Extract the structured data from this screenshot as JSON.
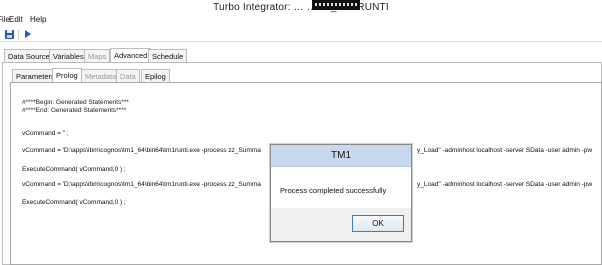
{
  "window": {
    "title": "Turbo Integrator: … … ze_Tm1RUNTI"
  },
  "menu": {
    "items": [
      "File",
      "Edit",
      "Help"
    ]
  },
  "toolbar": {
    "icons": [
      "save-icon",
      "run-icon"
    ]
  },
  "main_tabs": {
    "items": [
      {
        "label": "Data Source",
        "state": "normal"
      },
      {
        "label": "Variables",
        "state": "normal"
      },
      {
        "label": "Maps",
        "state": "disabled"
      },
      {
        "label": "Advanced",
        "state": "active"
      },
      {
        "label": "Schedule",
        "state": "normal"
      }
    ]
  },
  "sub_tabs": {
    "items": [
      {
        "label": "Parameters",
        "state": "normal"
      },
      {
        "label": "Prolog",
        "state": "active"
      },
      {
        "label": "Metadata",
        "state": "disabled"
      },
      {
        "label": "Data",
        "state": "disabled"
      },
      {
        "label": "Epilog",
        "state": "normal"
      }
    ]
  },
  "editor": {
    "lines": [
      "#****Begin: Generated Statements***",
      "#****End: Generated Statements****",
      "vCommand = '' ;",
      "vCommand = 'D:\\apps\\ibm\\cognos\\tm1_64\\bin64\\tm1runti.exe -process zz_Summa",
      "ExecuteCommand( vCommand,0 ) ;",
      "vCommand = 'D:\\apps\\ibm\\cognos\\tm1_64\\bin64\\tm1runti.exe -process zz_Summa",
      "ExecuteCommand( vCommand,0 ) ;"
    ],
    "line_tails": [
      "y_Load'' -adminhost localhost -server SData -user admin -pw",
      "y_Load'' -adminhost localhost -server SData -user admin -pw"
    ]
  },
  "dialog": {
    "title": "TM1",
    "message": "Process completed successfully",
    "ok_label": "OK"
  },
  "colors": {
    "dialog_title_bg": "#c8d8ee",
    "ok_border": "#3c7fb1",
    "run_icon": "#1f5fbf",
    "save_icon": "#2a5c9a"
  }
}
